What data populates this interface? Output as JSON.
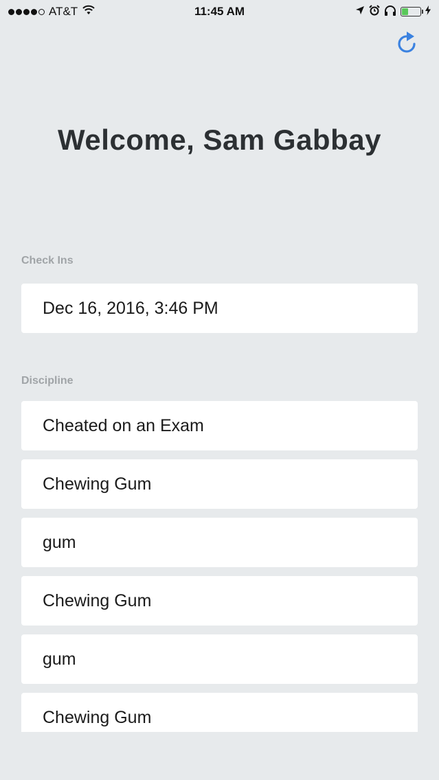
{
  "status_bar": {
    "carrier": "AT&T",
    "time": "11:45 AM",
    "battery_color": "#5ac85a",
    "signal_bars": 4,
    "signal_total": 5,
    "battery_level": 0.35
  },
  "header": {
    "refresh_icon": "refresh-icon",
    "title": "Welcome, Sam Gabbay"
  },
  "check_ins": {
    "label": "Check Ins",
    "items": [
      "Dec 16, 2016, 3:46 PM"
    ]
  },
  "discipline": {
    "label": "Discipline",
    "items": [
      "Cheated on an Exam",
      "Chewing Gum",
      "gum",
      "Chewing Gum",
      "gum",
      "Chewing Gum"
    ]
  },
  "colors": {
    "background": "#e7eaec",
    "accent": "#3b82e0",
    "section_label": "#a0a4a7"
  }
}
